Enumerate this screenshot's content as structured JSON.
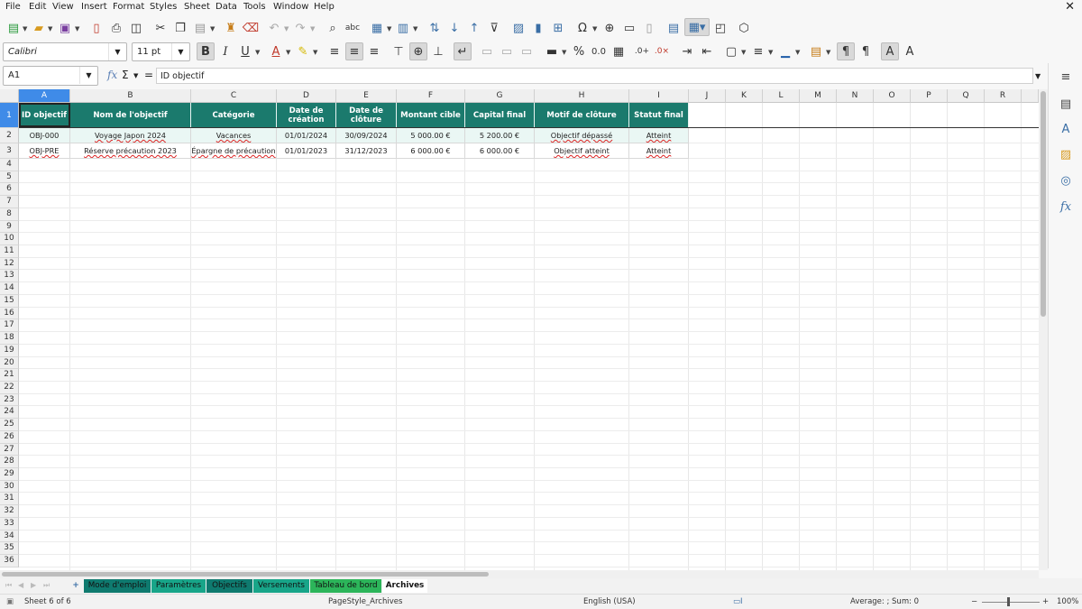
{
  "menu": [
    "File",
    "Edit",
    "View",
    "Insert",
    "Format",
    "Styles",
    "Sheet",
    "Data",
    "Tools",
    "Window",
    "Help"
  ],
  "font_name": "Calibri",
  "font_size": "11 pt",
  "name_box": "A1",
  "formula_symbols": {
    "fx": "fx",
    "sum": "Σ",
    "eq": "="
  },
  "formula_content": "ID objectif",
  "columns": [
    "A",
    "B",
    "C",
    "D",
    "E",
    "F",
    "G",
    "H",
    "I",
    "J",
    "K",
    "L",
    "M",
    "N",
    "O",
    "P",
    "Q",
    "R"
  ],
  "rows": [
    "1",
    "2",
    "3",
    "4",
    "5",
    "6",
    "7",
    "8",
    "9",
    "10",
    "11",
    "12",
    "13",
    "14",
    "15",
    "16",
    "17",
    "18",
    "19",
    "20",
    "21",
    "22",
    "23",
    "24",
    "25",
    "26",
    "27",
    "28",
    "29",
    "30",
    "31",
    "32",
    "33",
    "34",
    "35",
    "36"
  ],
  "table": {
    "headers": [
      "ID objectif",
      "Nom de l'objectif",
      "Catégorie",
      "Date de création",
      "Date de clôture",
      "Montant cible",
      "Capital final",
      "Motif de clôture",
      "Statut final"
    ],
    "rows": [
      [
        "OBJ-000",
        "Voyage Japon 2024",
        "Vacances",
        "01/01/2024",
        "30/09/2024",
        "5 000.00 €",
        "5 200.00 €",
        "Objectif dépassé",
        "Atteint"
      ],
      [
        "OBJ-PRE",
        "Réserve précaution 2023",
        "Épargne de précaution",
        "01/01/2023",
        "31/12/2023",
        "6 000.00 €",
        "6 000.00 €",
        "Objectif atteint",
        "Atteint"
      ]
    ]
  },
  "sheet_tabs": [
    {
      "label": "Mode d'emploi",
      "color": "#0f7a6f"
    },
    {
      "label": "Paramètres",
      "color": "#18a589"
    },
    {
      "label": "Objectifs",
      "color": "#0f7a6f"
    },
    {
      "label": "Versements",
      "color": "#18a589"
    },
    {
      "label": "Tableau de bord",
      "color": "#2cb55a"
    },
    {
      "label": "Archives",
      "color": "#ffffff"
    }
  ],
  "add_sheet": "+",
  "status": {
    "sheet": "Sheet 6 of 6",
    "page_style": "PageStyle_Archives",
    "language": "English (USA)",
    "summary": "Average: ; Sum: 0",
    "zoom": "100%",
    "zoom_minus": "−",
    "zoom_plus": "+"
  },
  "colors": {
    "header_bg": "#1b7a6d",
    "alt_row": "#eaf7f4",
    "selection": "#3f8be8"
  }
}
